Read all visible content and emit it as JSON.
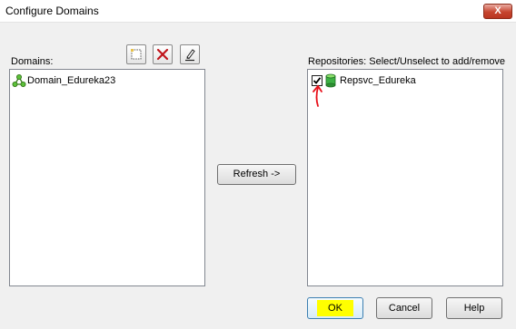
{
  "window": {
    "title": "Configure Domains",
    "close_glyph": "X"
  },
  "domains": {
    "label": "Domains:",
    "toolbar": [
      {
        "name": "new-domain-button",
        "icon": "new-item-icon"
      },
      {
        "name": "delete-domain-button",
        "icon": "delete-x-icon"
      },
      {
        "name": "edit-domain-button",
        "icon": "pencil-icon"
      }
    ],
    "items": [
      {
        "label": "Domain_Edureka23",
        "icon": "domain-network-icon"
      }
    ]
  },
  "refresh_label": "Refresh ->",
  "repositories": {
    "label": "Repositories: Select/Unselect to add/remove",
    "items": [
      {
        "label": "Repsvc_Edureka",
        "checked": true,
        "icon": "repository-database-icon"
      }
    ]
  },
  "buttons": {
    "ok": "OK",
    "cancel": "Cancel",
    "help": "Help"
  },
  "colors": {
    "annotation_red": "#e8101a",
    "highlight_yellow": "#ffff00",
    "db_green": "#3cb043"
  }
}
